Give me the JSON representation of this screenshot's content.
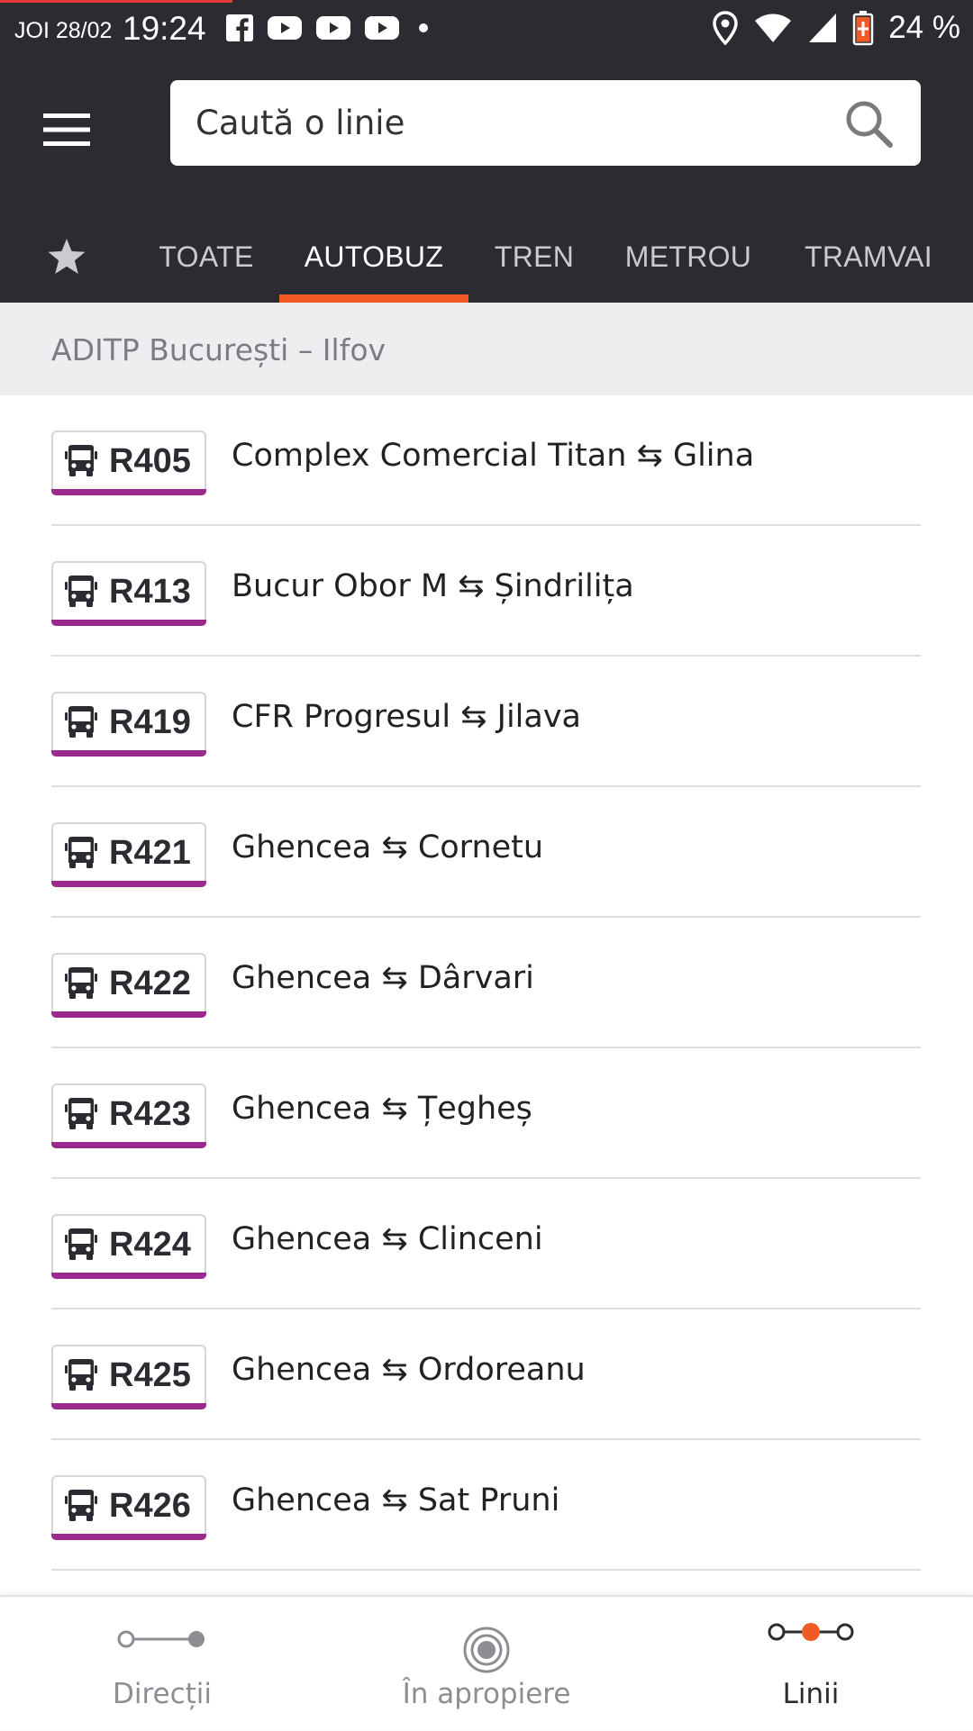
{
  "status_bar": {
    "date": "JOI 28/02",
    "time": "19:24",
    "notification_icons": [
      "facebook-icon",
      "youtube-icon",
      "youtube-icon",
      "youtube-icon",
      "dot-icon"
    ],
    "battery_percent": "24 %"
  },
  "search": {
    "placeholder": "Caută o linie"
  },
  "tabs": [
    {
      "label": "TOATE"
    },
    {
      "label": "AUTOBUZ"
    },
    {
      "label": "TREN"
    },
    {
      "label": "METROU"
    },
    {
      "label": "TRAMVAI"
    }
  ],
  "active_tab": "AUTOBUZ",
  "agency": {
    "title": "ADITP București – Ilfov"
  },
  "routes": [
    {
      "number": "R405",
      "name": "Complex Comercial Titan ⇆ Glina"
    },
    {
      "number": "R413",
      "name": "Bucur Obor M ⇆ Șindrilița"
    },
    {
      "number": "R419",
      "name": "CFR Progresul ⇆ Jilava"
    },
    {
      "number": "R421",
      "name": "Ghencea ⇆ Cornetu"
    },
    {
      "number": "R422",
      "name": "Ghencea ⇆ Dârvari"
    },
    {
      "number": "R423",
      "name": "Ghencea ⇆ Țegheș"
    },
    {
      "number": "R424",
      "name": "Ghencea ⇆ Clinceni"
    },
    {
      "number": "R425",
      "name": "Ghencea ⇆ Ordoreanu"
    },
    {
      "number": "R426",
      "name": "Ghencea ⇆ Sat Pruni"
    }
  ],
  "bottom_nav": {
    "directions": "Direcții",
    "nearby": "În apropiere",
    "lines": "Linii"
  },
  "colors": {
    "header_bg": "#2b2c31",
    "accent": "#f15a24",
    "route_badge_underline": "#9b2a8c"
  }
}
